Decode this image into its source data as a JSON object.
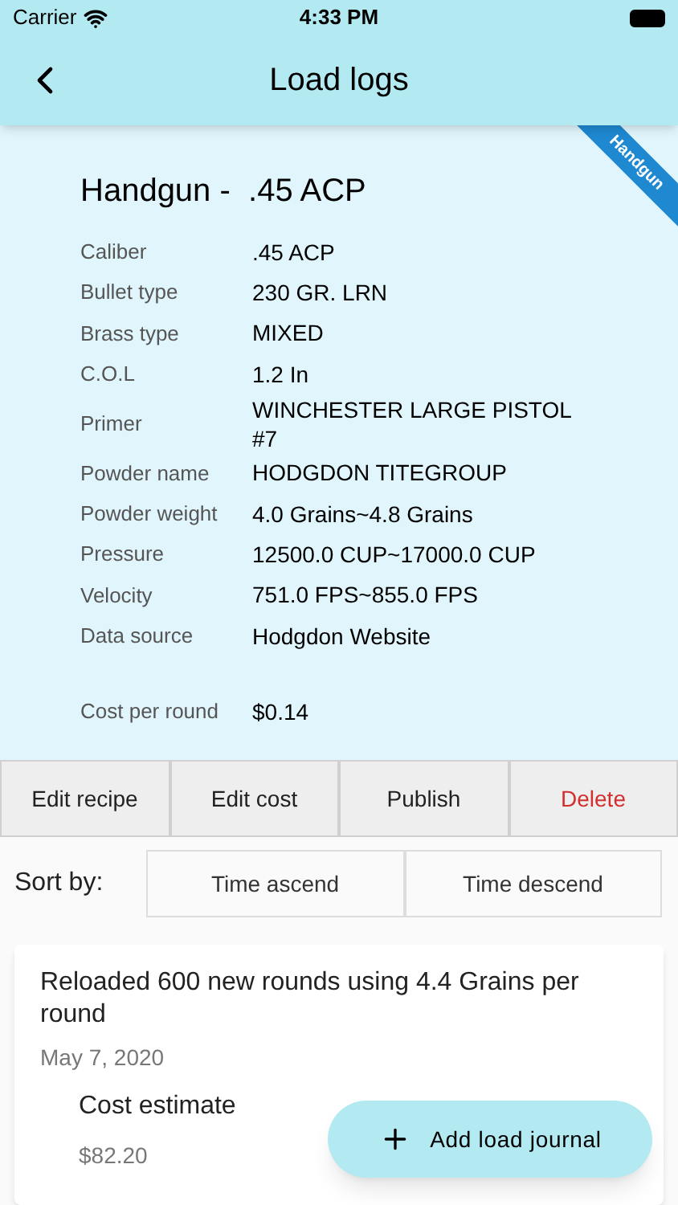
{
  "status_bar": {
    "carrier": "Carrier",
    "time": "4:33 PM"
  },
  "app_bar": {
    "title": "Load logs"
  },
  "recipe": {
    "ribbon": "Handgun",
    "title": "Handgun -  .45 ACP",
    "fields": [
      {
        "label": "Caliber",
        "value": ".45 ACP"
      },
      {
        "label": "Bullet type",
        "value": "230 GR. LRN"
      },
      {
        "label": "Brass type",
        "value": "MIXED"
      },
      {
        "label": "C.O.L",
        "value": "1.2 In"
      },
      {
        "label": "Primer",
        "value": "WINCHESTER LARGE PISTOL #7"
      },
      {
        "label": "Powder name",
        "value": "HODGDON TITEGROUP"
      },
      {
        "label": "Powder weight",
        "value": "4.0 Grains~4.8 Grains"
      },
      {
        "label": "Pressure",
        "value": "12500.0 CUP~17000.0 CUP"
      },
      {
        "label": "Velocity",
        "value": "751.0 FPS~855.0 FPS"
      },
      {
        "label": "Data source",
        "value": "Hodgdon Website"
      }
    ],
    "cost": {
      "label": "Cost per round",
      "value": "$0.14"
    }
  },
  "actions": [
    {
      "label": "Edit recipe",
      "destructive": false
    },
    {
      "label": "Edit cost",
      "destructive": false
    },
    {
      "label": "Publish",
      "destructive": false
    },
    {
      "label": "Delete",
      "destructive": true
    }
  ],
  "sort": {
    "label": "Sort by:",
    "options": [
      "Time ascend",
      "Time descend"
    ]
  },
  "journal": [
    {
      "text": "Reloaded 600 new rounds using 4.4 Grains per round",
      "date": "May 7, 2020",
      "cost_label": "Cost estimate",
      "cost": "$82.20"
    }
  ],
  "fab": {
    "label": "Add load journal"
  }
}
